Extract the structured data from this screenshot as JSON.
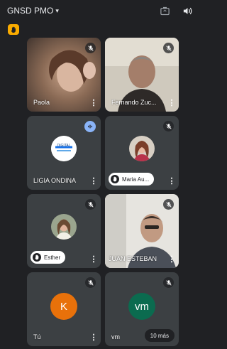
{
  "header": {
    "meeting_title": "GNSD PMO",
    "caret": "▾",
    "camera_switch_icon": "camera-switch-icon",
    "speaker_icon": "speaker-icon"
  },
  "status_badge_icon": "raised-hand-icon",
  "colors": {
    "background": "#202124",
    "tile": "#3c4043",
    "accent_badge": "#f9ab00",
    "speaking": "#8ab4f8",
    "avatar_k": "#e8710a",
    "avatar_vm": "#0b6b4f"
  },
  "participants": [
    {
      "name": "Paola",
      "muted": true,
      "video": true
    },
    {
      "name": "Fernando Zuc...",
      "muted": true,
      "video": true
    },
    {
      "name": "LIGIA ONDINA",
      "muted": false,
      "speaking": true,
      "logo_text": "DIGITAL"
    },
    {
      "name": "Maria Au...",
      "muted": true,
      "hand_raised": true
    },
    {
      "name": "Esther",
      "muted": true,
      "hand_raised": true
    },
    {
      "name": "JUAN ESTEBAN",
      "muted": true,
      "video": true
    },
    {
      "name": "Tú",
      "muted": true,
      "avatar_letter": "K"
    },
    {
      "name": "vm",
      "muted": true,
      "avatar_letter": "vm",
      "more_label": "10 más"
    }
  ]
}
